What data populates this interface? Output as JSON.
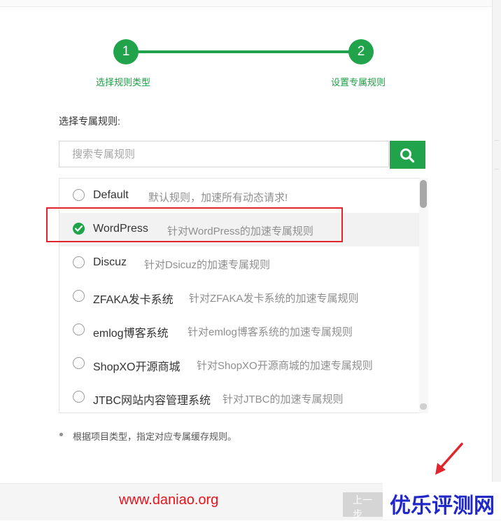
{
  "stepper": {
    "steps": [
      {
        "number": "1",
        "label": "选择规则类型"
      },
      {
        "number": "2",
        "label": "设置专属规则"
      }
    ]
  },
  "section_label": "选择专属规则:",
  "search": {
    "placeholder": "搜索专属规则",
    "value": ""
  },
  "rules": [
    {
      "name": "Default",
      "desc": "默认规则，加速所有动态请求!",
      "selected": false
    },
    {
      "name": "WordPress",
      "desc": "针对WordPress的加速专属规则",
      "selected": true
    },
    {
      "name": "Discuz",
      "desc": "针对Dsicuz的加速专属规则",
      "selected": false
    },
    {
      "name": "ZFAKA发卡系统",
      "desc": "针对ZFAKA发卡系统的加速专属规则",
      "selected": false
    },
    {
      "name": "emlog博客系统",
      "desc": "针对emlog博客系统的加速专属规则",
      "selected": false
    },
    {
      "name": "ShopXO开源商城",
      "desc": "针对ShopXO开源商城的加速专属规则",
      "selected": false
    },
    {
      "name": "JTBC网站内容管理系统",
      "desc": "针对JTBC的加速专属规则",
      "selected": false
    }
  ],
  "note": "根据项目类型，指定对应专属缓存规则。",
  "footer": {
    "prev_label": "上一步",
    "watermark_url": "www.daniao.org",
    "watermark_brand": "优乐评测网"
  },
  "colors": {
    "accent": "#20a34a",
    "annotation": "#e0262a",
    "brand": "#2128c8"
  },
  "icons": {
    "search_button": "search-icon",
    "selected_radio": "check-icon",
    "annotation_arrow": "arrow-icon"
  }
}
